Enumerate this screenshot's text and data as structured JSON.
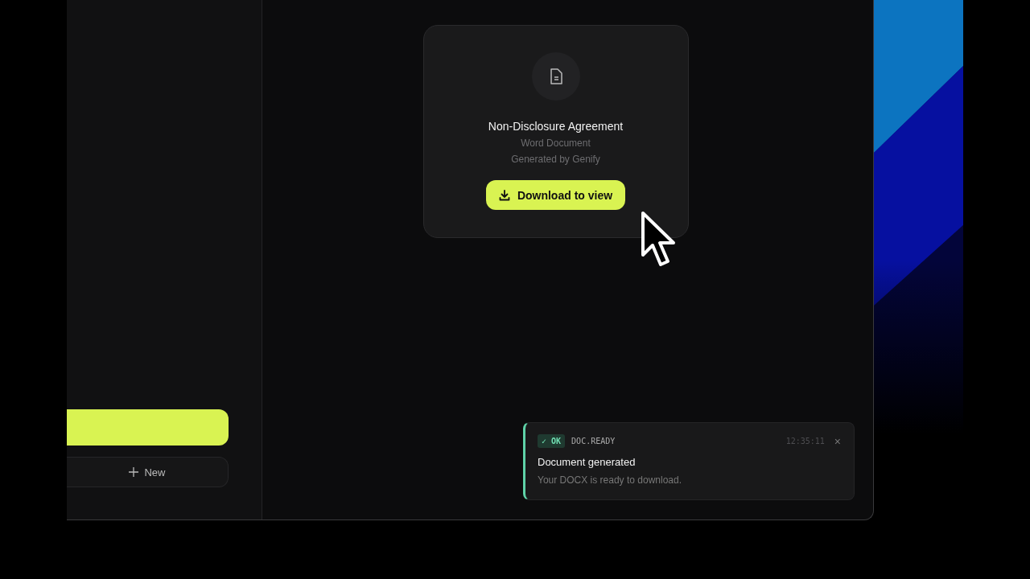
{
  "sidebar": {
    "new_button": {
      "label": "New"
    }
  },
  "document_card": {
    "title": "Non-Disclosure Agreement",
    "type": "Word Document",
    "source": "Generated by Genify",
    "button": "Download to view"
  },
  "toast": {
    "status": "✓ OK",
    "event": "DOC.READY",
    "time": "12:35:11",
    "close": "×",
    "title": "Document generated",
    "message": "Your DOCX is ready to download."
  }
}
